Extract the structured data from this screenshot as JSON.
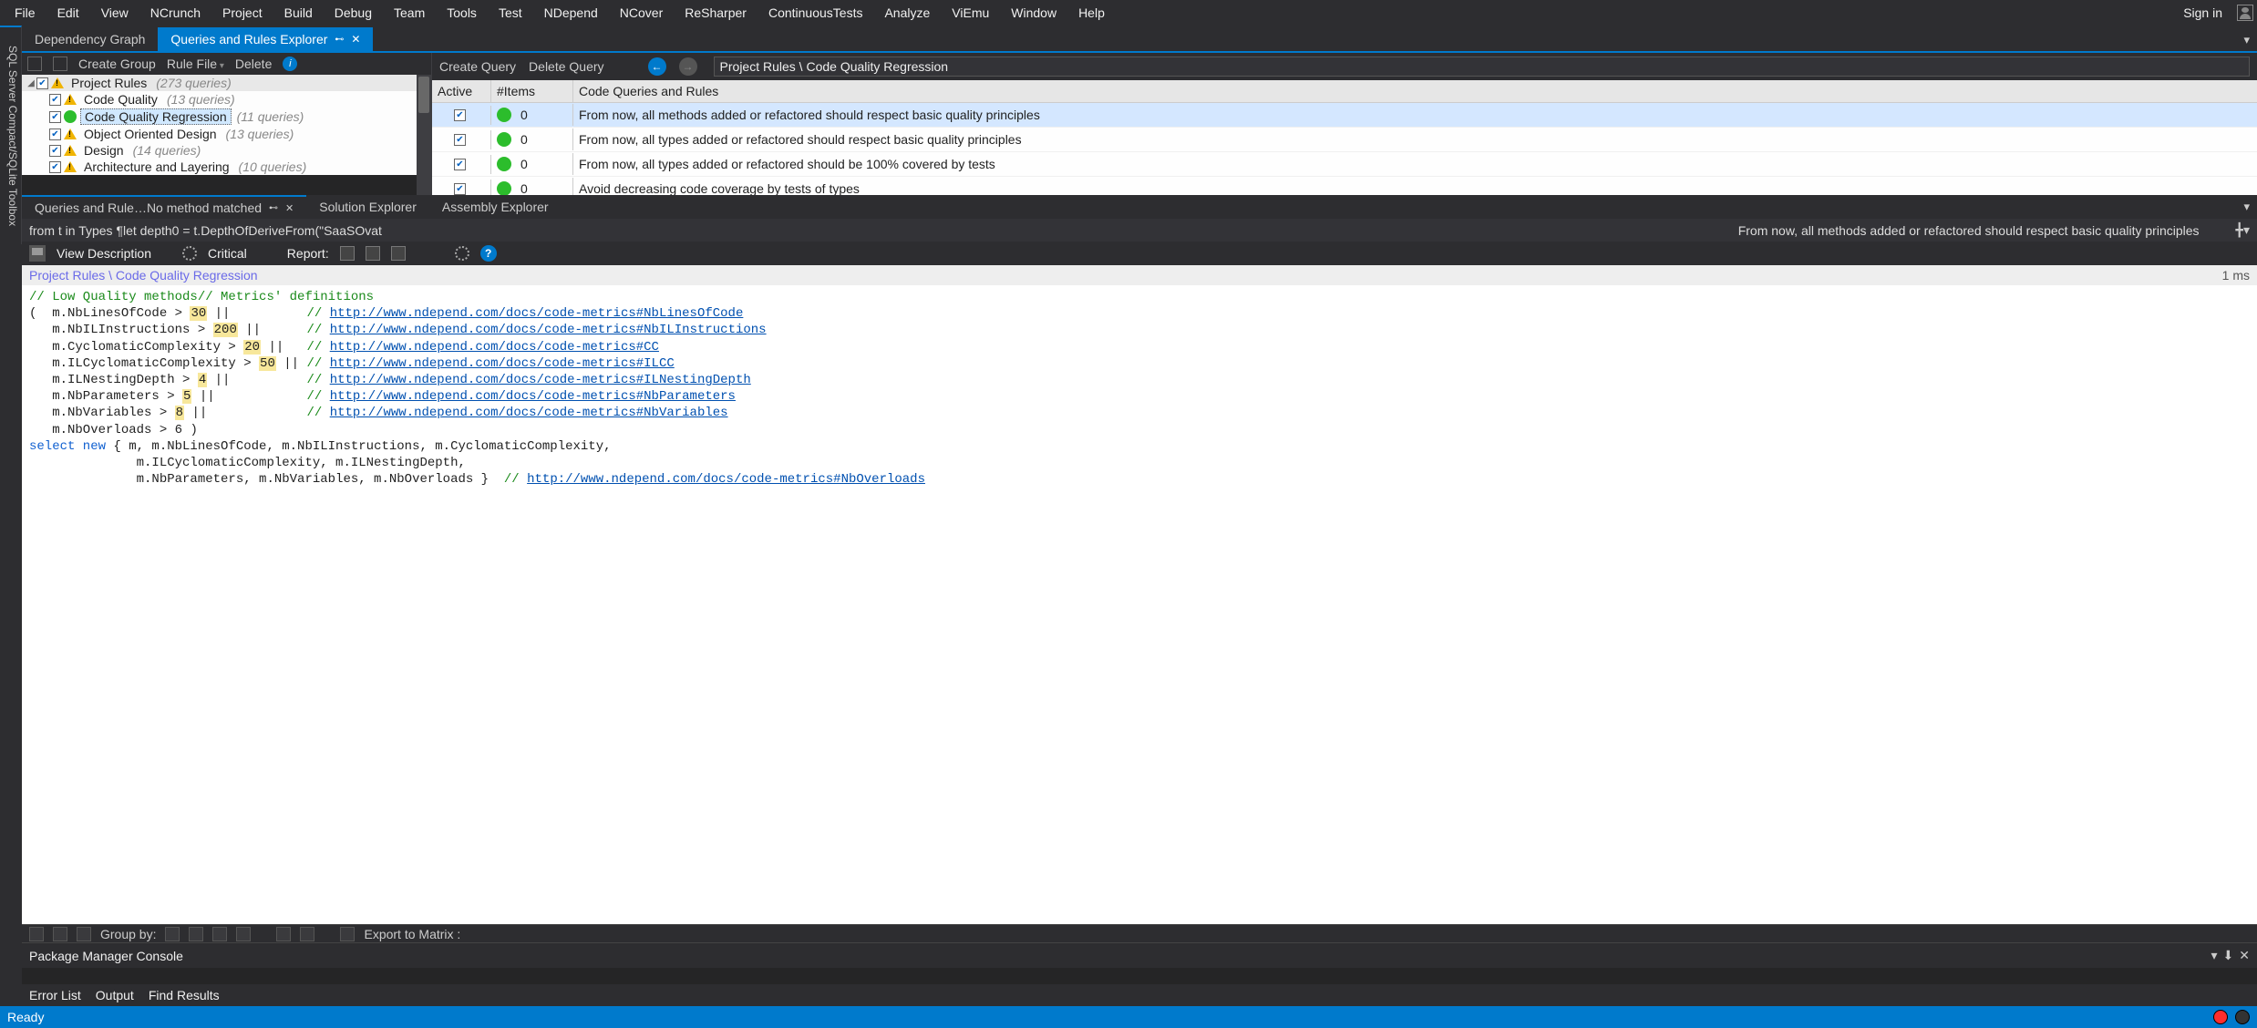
{
  "menu": [
    "File",
    "Edit",
    "View",
    "NCrunch",
    "Project",
    "Build",
    "Debug",
    "Team",
    "Tools",
    "Test",
    "NDepend",
    "NCover",
    "ReSharper",
    "ContinuousTests",
    "Analyze",
    "ViEmu",
    "Window",
    "Help"
  ],
  "sign_in": "Sign in",
  "side_tab": "SQL Server Compact/SQLite Toolbox",
  "doc_tabs": {
    "inactive": "Dependency Graph",
    "active": "Queries and Rules Explorer"
  },
  "tree_toolbar": {
    "create": "Create Group",
    "rule_file": "Rule File",
    "delete": "Delete"
  },
  "tree": [
    {
      "level": 0,
      "label": "Project Rules",
      "count": "(273 queries)",
      "selected": false,
      "icon": "warn"
    },
    {
      "level": 1,
      "label": "Code Quality",
      "count": "(13 queries)",
      "selected": false,
      "icon": "warn"
    },
    {
      "level": 1,
      "label": "Code Quality Regression",
      "count": "(11 queries)",
      "selected": true,
      "icon": "green"
    },
    {
      "level": 1,
      "label": "Object Oriented Design",
      "count": "(13 queries)",
      "selected": false,
      "icon": "warn"
    },
    {
      "level": 1,
      "label": "Design",
      "count": "(14 queries)",
      "selected": false,
      "icon": "warn"
    },
    {
      "level": 1,
      "label": "Architecture and Layering",
      "count": "(10 queries)",
      "selected": false,
      "icon": "warn"
    }
  ],
  "rules_toolbar": {
    "create": "Create Query",
    "delete": "Delete Query",
    "breadcrumb": "Project Rules \\ Code Quality Regression"
  },
  "rules_header": {
    "active": "Active",
    "items": "#Items",
    "rule": "Code Queries and Rules"
  },
  "rules": [
    {
      "n": "0",
      "text": "From now, all methods added or refactored should respect basic quality principles",
      "hl": true
    },
    {
      "n": "0",
      "text": "From now, all types added or refactored should respect basic quality principles",
      "hl": false
    },
    {
      "n": "0",
      "text": "From now, all types added or refactored should be 100% covered by tests",
      "hl": false
    },
    {
      "n": "0",
      "text": "Avoid decreasing code coverage by tests of types",
      "hl": false
    }
  ],
  "second_tabs": {
    "active": "Queries and Rule…No method matched",
    "others": [
      "Solution Explorer",
      "Assembly Explorer"
    ]
  },
  "graybar": {
    "left": "from t in Types ¶let depth0 = t.DepthOfDeriveFrom(\"SaaSOvat",
    "right": "From now, all methods added or refactored should respect basic quality principles"
  },
  "editor_tb": {
    "view": "View Description",
    "critical": "Critical",
    "report": "Report:"
  },
  "editor_breadcrumb": "Project Rules \\ Code Quality Regression",
  "timing": "1 ms",
  "code": {
    "c1": "// Low Quality methods// Metrics' definitions",
    "l1a": "(  m.NbLinesOfCode > ",
    "l1n": "30",
    "l1b": " ||          ",
    "l1c": "// ",
    "l1u": "http://www.ndepend.com/docs/code-metrics#NbLinesOfCode",
    "l2a": "   m.NbILInstructions > ",
    "l2n": "200",
    "l2b": " ||      ",
    "l2c": "// ",
    "l2u": "http://www.ndepend.com/docs/code-metrics#NbILInstructions",
    "l3a": "   m.CyclomaticComplexity > ",
    "l3n": "20",
    "l3b": " ||   ",
    "l3c": "// ",
    "l3u": "http://www.ndepend.com/docs/code-metrics#CC",
    "l4a": "   m.ILCyclomaticComplexity > ",
    "l4n": "50",
    "l4b": " || ",
    "l4c": "// ",
    "l4u": "http://www.ndepend.com/docs/code-metrics#ILCC",
    "l5a": "   m.ILNestingDepth > ",
    "l5n": "4",
    "l5b": " ||          ",
    "l5c": "// ",
    "l5u": "http://www.ndepend.com/docs/code-metrics#ILNestingDepth",
    "l6a": "   m.NbParameters > ",
    "l6n": "5",
    "l6b": " ||            ",
    "l6c": "// ",
    "l6u": "http://www.ndepend.com/docs/code-metrics#NbParameters",
    "l7a": "   m.NbVariables > ",
    "l7n": "8",
    "l7b": " ||             ",
    "l7c": "// ",
    "l7u": "http://www.ndepend.com/docs/code-metrics#NbVariables",
    "l8a": "   m.NbOverloads > ",
    "l8n": "6",
    "l8b": " )",
    "sel": "select new",
    "selrest": " { m, m.NbLinesOfCode, m.NbILInstructions, m.CyclomaticComplexity,",
    "sel2": "              m.ILCyclomaticComplexity, m.ILNestingDepth,",
    "sel3a": "              m.NbParameters, m.NbVariables, m.NbOverloads }  ",
    "sel3c": "// ",
    "sel3u": "http://www.ndepend.com/docs/code-metrics#NbOverloads"
  },
  "groupby": {
    "label": "Group by:",
    "export": "Export to Matrix :"
  },
  "pm_console": "Package Manager Console",
  "bottom_tabs": [
    "Error List",
    "Output",
    "Find Results"
  ],
  "status": "Ready"
}
